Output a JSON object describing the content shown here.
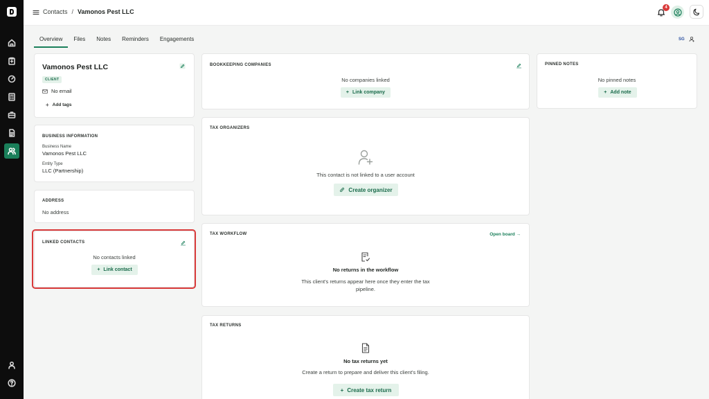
{
  "topbar": {
    "breadcrumb_root": "Contacts",
    "breadcrumb_sep": "/",
    "breadcrumb_current": "Vamonos Pest LLC",
    "notification_count": "4"
  },
  "tabs": [
    "Overview",
    "Files",
    "Notes",
    "Reminders",
    "Engagements"
  ],
  "tab_right": {
    "initials": "SG"
  },
  "contact_card": {
    "name": "Vamonos Pest LLC",
    "tag": "CLIENT",
    "email": "No email",
    "add_tags": "Add tags"
  },
  "business_info": {
    "title": "BUSINESS INFORMATION",
    "name_label": "Business Name",
    "name_value": "Vamonos Pest LLC",
    "entity_label": "Entity Type",
    "entity_value": "LLC (Partnership)"
  },
  "address": {
    "title": "ADDRESS",
    "value": "No address"
  },
  "linked_contacts": {
    "title": "LINKED CONTACTS",
    "empty": "No contacts linked",
    "button": "Link contact"
  },
  "bookkeeping": {
    "title": "BOOKKEEPING COMPANIES",
    "empty": "No companies linked",
    "button": "Link company"
  },
  "tax_organizers": {
    "title": "TAX ORGANIZERS",
    "empty": "This contact is not linked to a user account",
    "button": "Create organizer"
  },
  "tax_workflow": {
    "title": "TAX WORKFLOW",
    "link": "Open board →",
    "empty_title": "No returns in the workflow",
    "empty_line1": "This client's returns appear here once they enter the tax",
    "empty_line2": "pipeline."
  },
  "tax_returns": {
    "title": "TAX RETURNS",
    "empty_title": "No tax returns yet",
    "empty_desc": "Create a return to prepare and deliver this client's filing.",
    "button": "Create tax return"
  },
  "pinned_notes": {
    "title": "PINNED NOTES",
    "empty": "No pinned notes",
    "button": "Add note"
  },
  "colors": {
    "accent": "#1a7f5a",
    "accent_bg": "#e4f2ea",
    "highlight": "#d93a3a",
    "sidebar": "#0d0d0d"
  }
}
